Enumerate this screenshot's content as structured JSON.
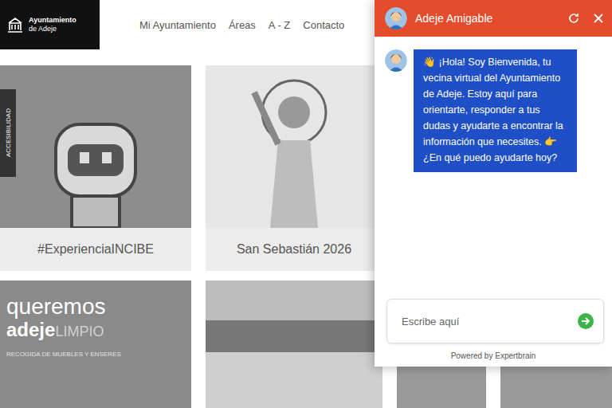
{
  "page": {
    "logo": {
      "line1": "Ayuntamiento",
      "line2": "de Adeje"
    },
    "nav": [
      "Mi Ayuntamiento",
      "Áreas",
      "A - Z",
      "Contacto"
    ],
    "accessibility_tab": "ACCESIBILIDAD",
    "tiles": [
      {
        "label": "#ExperienciaINCIBE",
        "kind": "robot"
      },
      {
        "label": "San Sebastián 2026",
        "kind": "saint"
      }
    ],
    "banner": {
      "title1": "queremos",
      "title2": "adeje",
      "title3": "LIMPIO",
      "subtitle": "RECOGIDA DE MUEBLES Y ENSERES"
    }
  },
  "chat": {
    "title": "Adeje Amigable",
    "messages": [
      {
        "from": "bot",
        "text": "👋 ¡Hola! Soy Bienvenida, tu vecina virtual del Ayuntamiento de Adeje. Estoy aquí para orientarte, responder a tus dudas y ayudarte a encontrar la información que necesites. 👉 ¿En qué puedo ayudarte hoy?"
      }
    ],
    "input": {
      "placeholder": "Escribe aquí"
    },
    "footer": "Powered by Expertbrain"
  }
}
